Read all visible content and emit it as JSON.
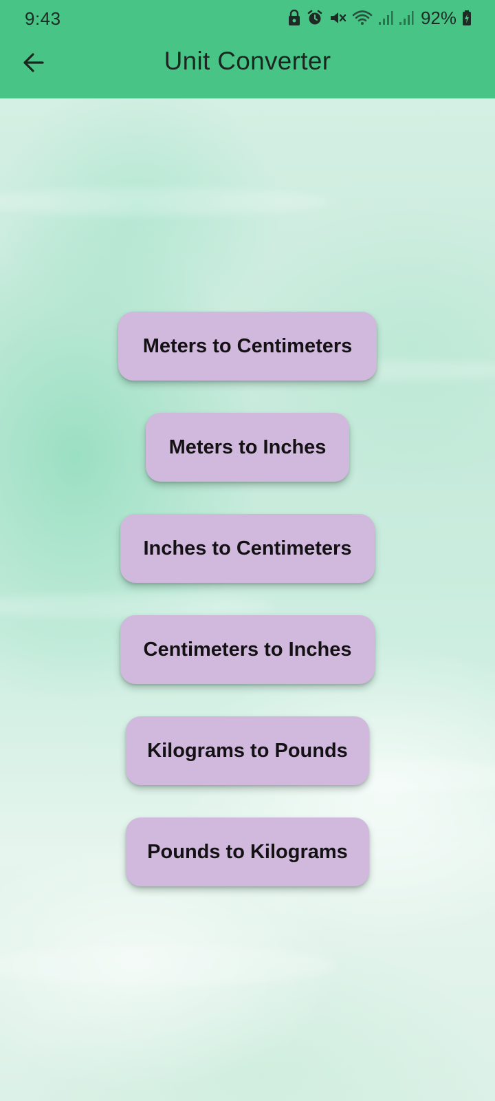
{
  "status_bar": {
    "time": "9:43",
    "battery_percent": "92%",
    "icons": [
      "lock-icon",
      "alarm-icon",
      "mute-icon",
      "wifi-icon",
      "signal-icon",
      "signal-icon-2",
      "battery-charging-icon"
    ]
  },
  "app_bar": {
    "title": "Unit Converter",
    "back_icon": "arrow-back-icon",
    "color": "#48c586"
  },
  "buttons": [
    {
      "label": "Meters to Centimeters"
    },
    {
      "label": "Meters to Inches"
    },
    {
      "label": "Inches to Centimeters"
    },
    {
      "label": "Centimeters to Inches"
    },
    {
      "label": "Kilograms to Pounds"
    },
    {
      "label": "Pounds to Kilograms"
    }
  ],
  "colors": {
    "button_bg": "#d1b9de",
    "button_text": "#141114",
    "background": "#cdeee0"
  }
}
